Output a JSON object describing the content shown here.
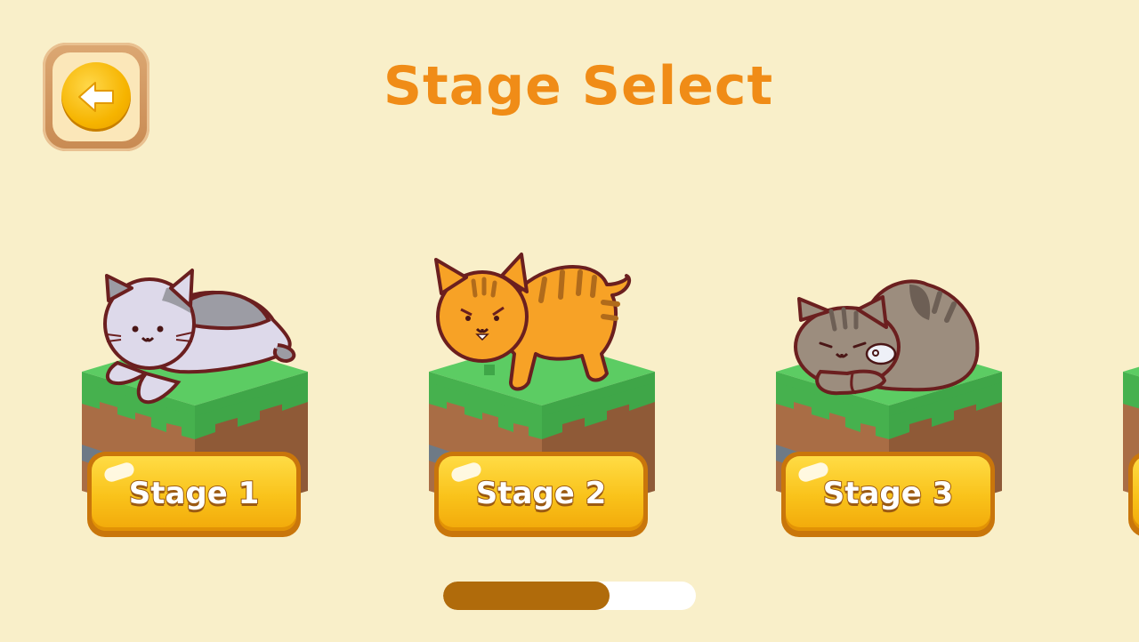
{
  "header": {
    "title": "Stage Select",
    "back_icon": "back-arrow-icon"
  },
  "stages": [
    {
      "label": "Stage 1",
      "cat": "gray-white-cat-lying"
    },
    {
      "label": "Stage 2",
      "cat": "orange-tabby-cat-standing"
    },
    {
      "label": "Stage 3",
      "cat": "brown-tabby-cat-sleeping"
    }
  ],
  "scroll_progress": {
    "fraction": 0.66
  },
  "colors": {
    "background": "#f9efc9",
    "title": "#f08c17",
    "button": "#f9c21a",
    "grass": "#4cbf5a",
    "dirt": "#a96d45",
    "progress_fill": "#b06b0b",
    "progress_track": "#ffffff"
  }
}
